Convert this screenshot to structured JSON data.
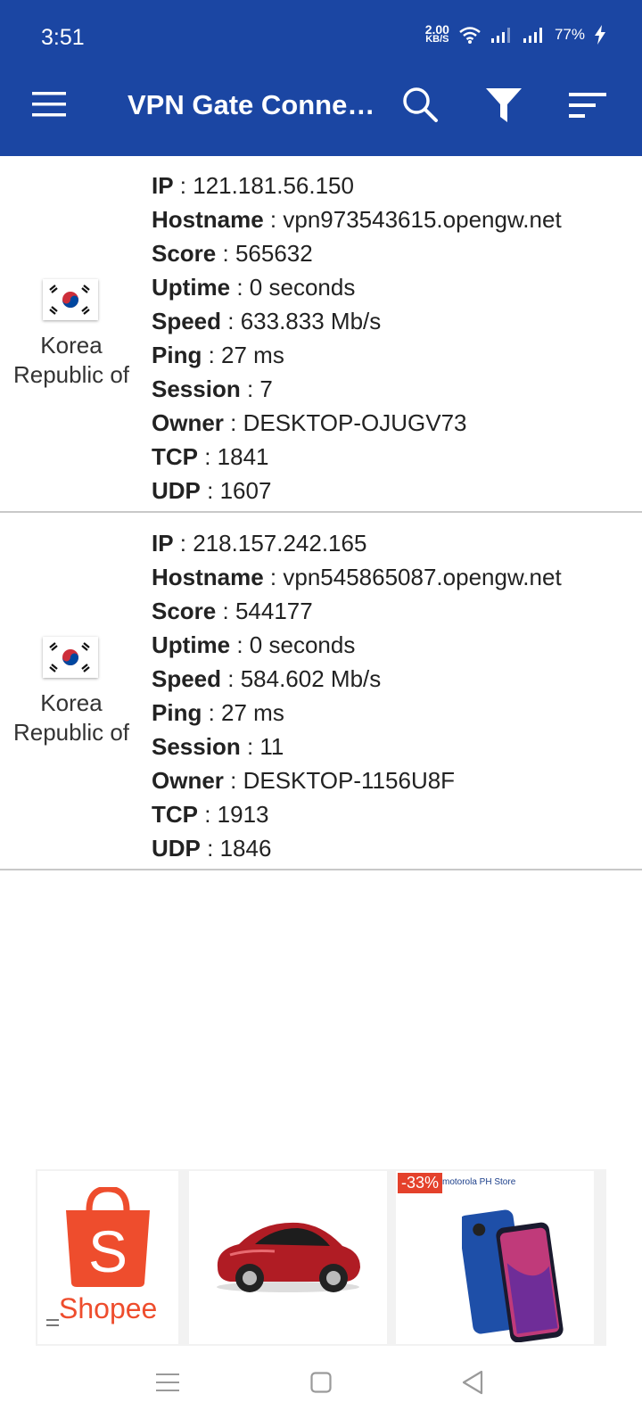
{
  "status_bar": {
    "time": "3:51",
    "net_speed_value": "2.00",
    "net_speed_unit": "KB/S",
    "battery": "77%"
  },
  "app_bar": {
    "title": "VPN Gate Conne…",
    "icons": [
      "menu-icon",
      "search-icon",
      "filter-icon",
      "sort-icon"
    ]
  },
  "colors": {
    "app_bar": "#1b46a3",
    "divider": "#c8c8c8",
    "shopee": "#ee4d2d"
  },
  "servers": [
    {
      "country_line1": "Korea",
      "country_line2": "Republic of",
      "fields": [
        {
          "key": "IP",
          "value": "121.181.56.150"
        },
        {
          "key": "Hostname",
          "value": "vpn973543615.opengw.net"
        },
        {
          "key": "Score",
          "value": "565632"
        },
        {
          "key": "Uptime",
          "value": "0 seconds"
        },
        {
          "key": "Speed",
          "value": "633.833 Mb/s"
        },
        {
          "key": "Ping",
          "value": "27 ms"
        },
        {
          "key": "Session",
          "value": "7"
        },
        {
          "key": "Owner",
          "value": "DESKTOP-OJUGV73"
        },
        {
          "key": "TCP",
          "value": "1841"
        },
        {
          "key": "UDP",
          "value": "1607"
        }
      ]
    },
    {
      "country_line1": "Korea",
      "country_line2": "Republic of",
      "fields": [
        {
          "key": "IP",
          "value": "218.157.242.165"
        },
        {
          "key": "Hostname",
          "value": "vpn545865087.opengw.net"
        },
        {
          "key": "Score",
          "value": "544177"
        },
        {
          "key": "Uptime",
          "value": "0 seconds"
        },
        {
          "key": "Speed",
          "value": "584.602 Mb/s"
        },
        {
          "key": "Ping",
          "value": "27 ms"
        },
        {
          "key": "Session",
          "value": "11"
        },
        {
          "key": "Owner",
          "value": "DESKTOP-1156U8F"
        },
        {
          "key": "TCP",
          "value": "1913"
        },
        {
          "key": "UDP",
          "value": "1846"
        }
      ]
    }
  ],
  "ad": {
    "brand": "Shopee",
    "logo_letter": "S",
    "discount": "-33%",
    "store_label": "motorola PH Store"
  },
  "nav_bar": {
    "icons": [
      "recents-icon",
      "home-icon",
      "back-icon"
    ]
  }
}
